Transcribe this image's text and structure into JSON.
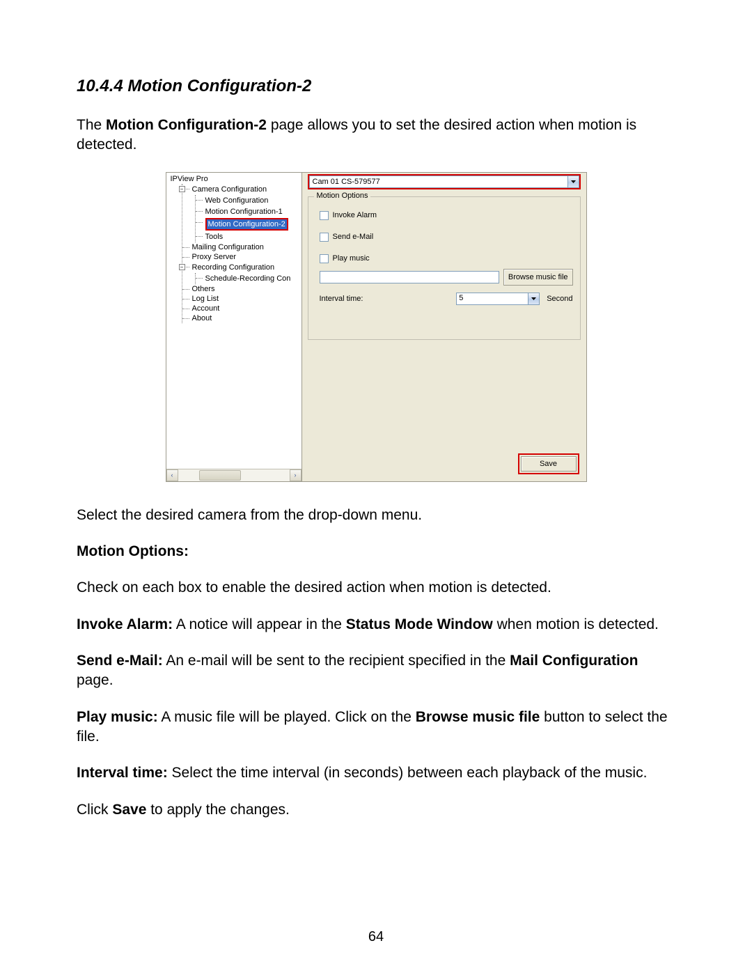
{
  "doc": {
    "heading": "10.4.4 Motion Configuration-2",
    "intro_pre": "The ",
    "intro_bold": "Motion Configuration-2",
    "intro_post": " page allows you to set the desired action when motion is detected.",
    "p_select": "Select the desired camera from the drop-down menu.",
    "motion_options_label": "Motion Options:",
    "p_check": "Check on each box to enable the desired action when motion is detected.",
    "invoke_b": "Invoke Alarm:",
    "invoke_t1": " A notice will appear in the ",
    "invoke_b2": "Status Mode Window",
    "invoke_t2": " when motion is detected.",
    "sendmail_b": "Send e-Mail:",
    "sendmail_t1": " An e-mail will be sent to the recipient specified in the ",
    "sendmail_b2": "Mail Configuration",
    "sendmail_t2": " page.",
    "play_b": "Play music:",
    "play_t1": " A music file will be played. Click on the ",
    "play_b2": "Browse music file",
    "play_t2": " button to select the file.",
    "interval_b": "Interval time:",
    "interval_t": " Select the time interval (in seconds) between each playback of the music.",
    "save_pre": "Click ",
    "save_b": "Save",
    "save_post": " to apply the changes.",
    "page_number": "64"
  },
  "app": {
    "tree_root": "IPView Pro",
    "tree": {
      "camera_cfg": "Camera Configuration",
      "web_cfg": "Web Configuration",
      "motion1": "Motion Configuration-1",
      "motion2": "Motion Configuration-2",
      "tools": "Tools",
      "mailing": "Mailing Configuration",
      "proxy": "Proxy Server",
      "recording": "Recording Configuration",
      "schedule": "Schedule-Recording Con",
      "others": "Others",
      "loglist": "Log List",
      "account": "Account",
      "about": "About"
    },
    "expander_minus": "−",
    "scroll_left": "‹",
    "scroll_right": "›",
    "camera_selected": "Cam 01    CS-579577",
    "groupbox_title": "Motion Options",
    "chk_invoke": "Invoke Alarm",
    "chk_sendmail": "Send e-Mail",
    "chk_playmusic": "Play music",
    "music_path": "",
    "browse_label": "Browse music file",
    "interval_label": "Interval time:",
    "interval_value": "5",
    "interval_unit": "Second",
    "save_label": "Save"
  }
}
